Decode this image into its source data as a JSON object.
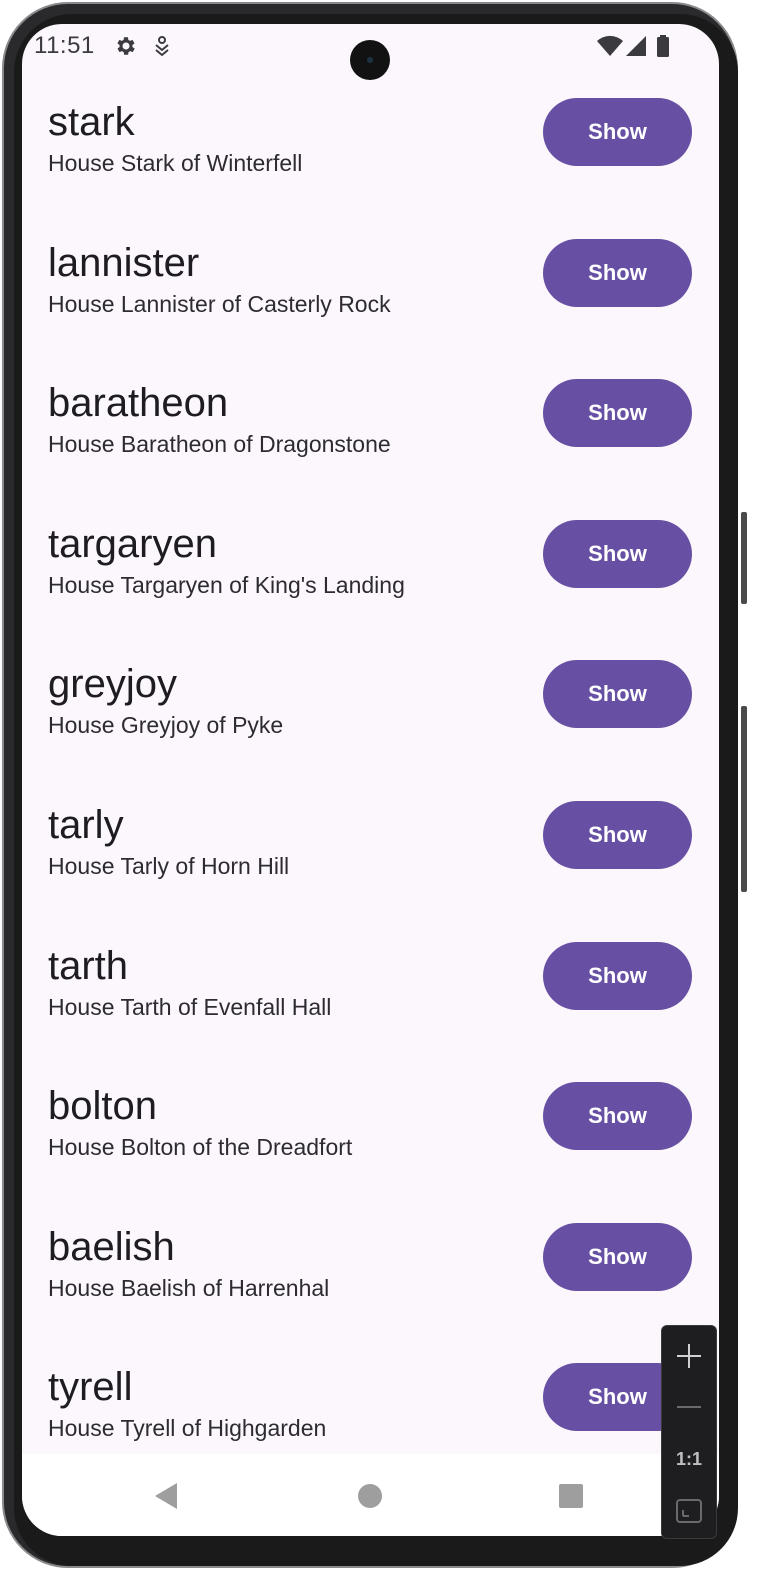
{
  "status_bar": {
    "time": "11:51",
    "icons": [
      "gear-icon",
      "download-icon",
      "wifi-icon",
      "signal-icon",
      "battery-icon"
    ]
  },
  "houses": [
    {
      "name": "stark",
      "description": "House Stark of Winterfell",
      "button_label": "Show"
    },
    {
      "name": "lannister",
      "description": "House Lannister of Casterly Rock",
      "button_label": "Show"
    },
    {
      "name": "baratheon",
      "description": "House Baratheon of Dragonstone",
      "button_label": "Show"
    },
    {
      "name": "targaryen",
      "description": "House Targaryen of King's Landing",
      "button_label": "Show"
    },
    {
      "name": "greyjoy",
      "description": "House Greyjoy of Pyke",
      "button_label": "Show"
    },
    {
      "name": "tarly",
      "description": "House Tarly of Horn Hill",
      "button_label": "Show"
    },
    {
      "name": "tarth",
      "description": "House Tarth of Evenfall Hall",
      "button_label": "Show"
    },
    {
      "name": "bolton",
      "description": "House Bolton of the Dreadfort",
      "button_label": "Show"
    },
    {
      "name": "baelish",
      "description": "House Baelish of Harrenhal",
      "button_label": "Show"
    },
    {
      "name": "tyrell",
      "description": "House Tyrell of Highgarden",
      "button_label": "Show"
    }
  ],
  "nav_bar": {
    "icons": [
      "back-icon",
      "home-icon",
      "recents-icon"
    ]
  },
  "zoom_controls": {
    "actual_size_label": "1:1",
    "icons": [
      "zoom-in-icon",
      "zoom-out-icon",
      "fit-screen-icon"
    ]
  },
  "colors": {
    "accent": "#6750a4",
    "background": "#fcf7fd",
    "text": "#1e1c22"
  }
}
